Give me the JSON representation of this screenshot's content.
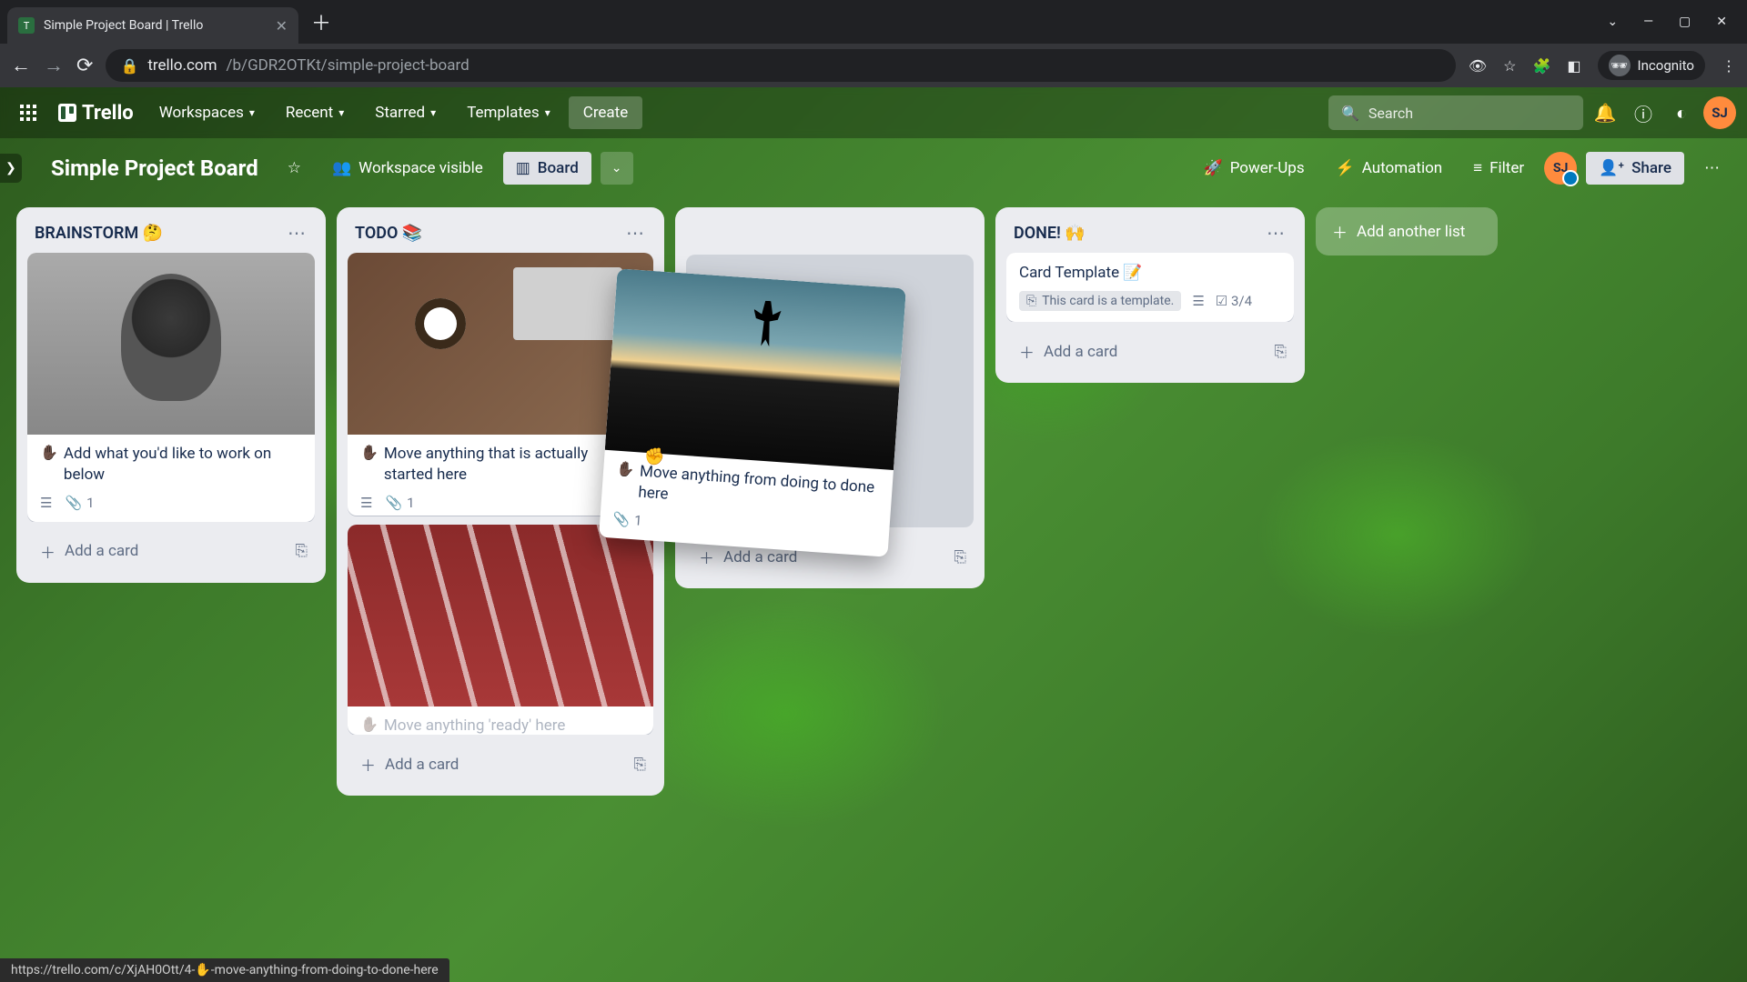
{
  "browser": {
    "tab_title": "Simple Project Board | Trello",
    "url_host": "trello.com",
    "url_path": "/b/GDR2OTKt/simple-project-board",
    "incognito_label": "Incognito"
  },
  "trello_header": {
    "logo_text": "Trello",
    "nav": [
      "Workspaces",
      "Recent",
      "Starred",
      "Templates"
    ],
    "create": "Create",
    "search_placeholder": "Search"
  },
  "board_bar": {
    "title": "Simple Project Board",
    "visibility": "Workspace visible",
    "view_label": "Board",
    "power_ups": "Power-Ups",
    "automation": "Automation",
    "filter": "Filter",
    "share": "Share",
    "member_initials": "SJ"
  },
  "lists": {
    "brainstorm": {
      "title": "BRAINSTORM 🤔",
      "card1_text": "Add what you'd like to work on below",
      "card1_attach": "1",
      "add_card": "Add a card"
    },
    "todo": {
      "title": "TODO 📚",
      "card1_text": "Move anything that is actually started here",
      "card1_attach": "1",
      "card2_text": "Move anything 'ready' here",
      "add_card": "Add a card"
    },
    "doing": {
      "add_card": "Add a card"
    },
    "done": {
      "title": "DONE! 🙌",
      "card_title": "Card Template 📝",
      "template_badge": "This card is a template.",
      "checklist": "3/4",
      "add_card": "Add a card"
    },
    "add_list": "Add another list"
  },
  "dragging": {
    "text": "Move anything from doing to done here",
    "attach": "1"
  },
  "avatar_initials": "SJ",
  "status_url": "https://trello.com/c/XjAH0Ott/4-✋-move-anything-from-doing-to-done-here"
}
